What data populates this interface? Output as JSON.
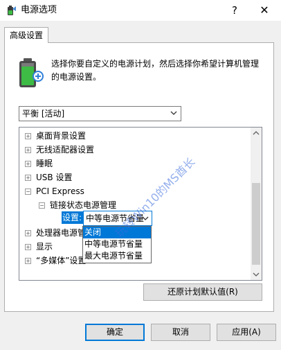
{
  "window": {
    "title": "电源选项",
    "help_glyph": "?",
    "close_glyph": "✕"
  },
  "tab": {
    "label": "高级设置"
  },
  "description": "选择你要自定义的电源计划，然后选择你希望计算机管理的电源设置。",
  "plan_select": {
    "value": "平衡 [活动]",
    "icon": "chevron-down-icon"
  },
  "tree": {
    "items": [
      {
        "toggle": "+",
        "label": "桌面背景设置"
      },
      {
        "toggle": "+",
        "label": "无线适配器设置"
      },
      {
        "toggle": "+",
        "label": "睡眠"
      },
      {
        "toggle": "+",
        "label": "USB 设置"
      },
      {
        "toggle": "−",
        "label": "PCI Express"
      },
      {
        "toggle": "−",
        "label": "链接状态电源管理"
      },
      {
        "toggle": "",
        "label": "设置:"
      },
      {
        "toggle": "+",
        "label": "处理器电源管"
      },
      {
        "toggle": "+",
        "label": "显示"
      },
      {
        "toggle": "+",
        "label": "“多媒体”设置"
      }
    ],
    "setting_value": "中等电源节省量"
  },
  "dropdown": {
    "options": [
      "关闭",
      "中等电源节省量",
      "最大电源节省量"
    ],
    "selected_index": 0
  },
  "buttons": {
    "restore": "还原计划默认值(R)",
    "ok": "确定",
    "cancel": "取消",
    "apply": "应用(A)"
  },
  "watermark": "玩转Win10的MS酋长",
  "colors": {
    "accent": "#0078d7",
    "battery_green": "#3dbb45"
  }
}
